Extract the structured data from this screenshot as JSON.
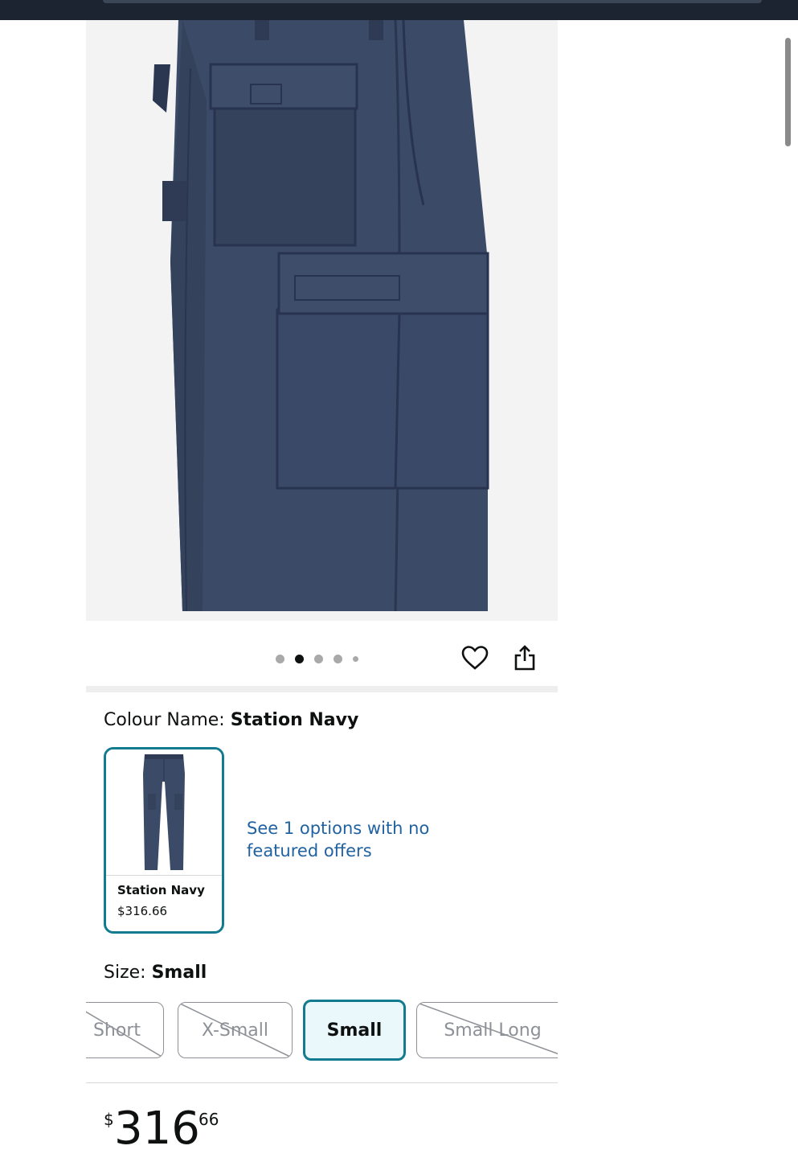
{
  "colour": {
    "label": "Colour Name: ",
    "value": "Station Navy"
  },
  "swatch": {
    "name": "Station Navy",
    "price": "$316.66"
  },
  "see_options": "See 1 options with no featured offers",
  "size": {
    "label": "Size: ",
    "value": "Small",
    "options": [
      {
        "label": "Short",
        "available": false
      },
      {
        "label": "X-Small",
        "available": false
      },
      {
        "label": "Small",
        "available": true,
        "selected": true
      },
      {
        "label": "Small Long",
        "available": false
      }
    ]
  },
  "gallery": {
    "image_count": 5,
    "active_index": 1
  },
  "price": {
    "currency_symbol": "$",
    "whole": "316",
    "fraction": "66"
  },
  "icons": {
    "wishlist": "heart-icon",
    "share": "share-icon"
  },
  "colors": {
    "accent": "#127b8f",
    "link": "#2162a1",
    "product": "#3b4a66"
  }
}
